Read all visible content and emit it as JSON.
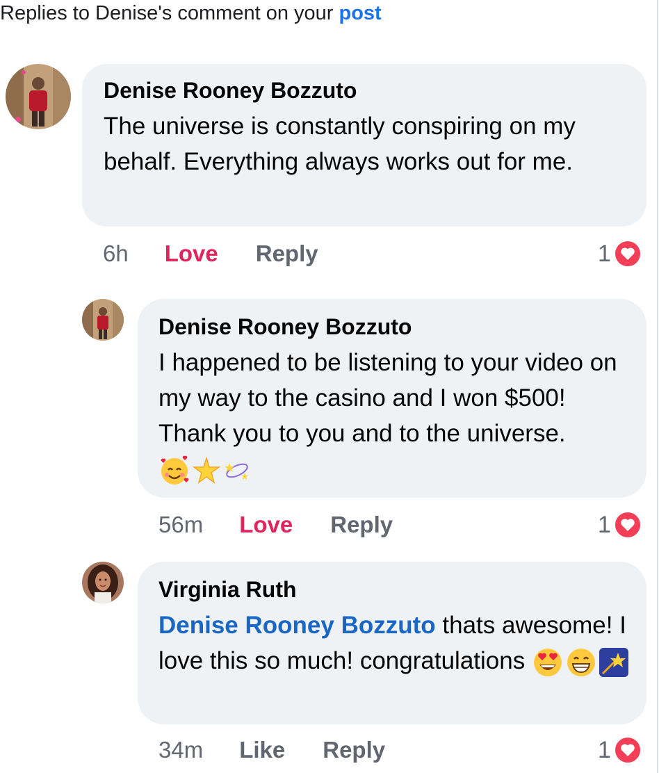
{
  "header": {
    "prefix": "Replies to Denise's comment on your",
    "link_label": "post"
  },
  "comments": [
    {
      "author": "Denise Rooney Bozzuto",
      "text": "The universe is constantly conspiring on my behalf. Everything always works out for me.",
      "time": "6h",
      "action_primary": "Love",
      "action_reply": "Reply",
      "reaction_count": "1"
    },
    {
      "author": "Denise Rooney Bozzuto",
      "text": "I happened to be listening to your video on my way to the casino and I won $500! Thank you to you and to the universe.",
      "time": "56m",
      "action_primary": "Love",
      "action_reply": "Reply",
      "reaction_count": "1",
      "emojis": [
        "smiling-face-with-hearts",
        "glowing-star",
        "dizzy-sparkle"
      ]
    },
    {
      "author": "Virginia Ruth",
      "mention": "Denise Rooney Bozzuto",
      "text": "thats awesome! I love this so much! congratulations",
      "time": "34m",
      "action_primary": "Like",
      "action_reply": "Reply",
      "reaction_count": "1",
      "emojis": [
        "heart-eyes",
        "grinning-face",
        "shooting-star"
      ]
    }
  ],
  "colors": {
    "bubble": "#eff2f5",
    "love": "#e0245e",
    "mention": "#1a66c4",
    "link": "#1a73e8",
    "heart": "#f33e58"
  }
}
